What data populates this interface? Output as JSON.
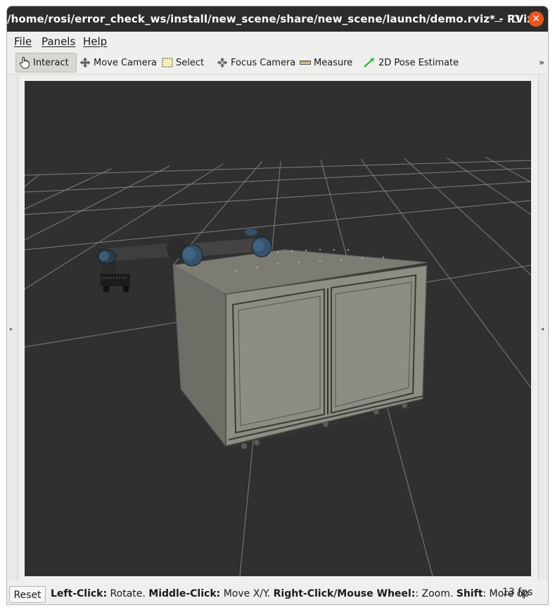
{
  "window": {
    "title": "/home/rosi/error_check_ws/install/new_scene/share/new_scene/launch/demo.rviz* - RViz",
    "close_glyph": "✕"
  },
  "menu": {
    "file": "File",
    "panels": "Panels",
    "help": "Help"
  },
  "toolbar": {
    "interact": "Interact",
    "move_camera": "Move Camera",
    "select": "Select",
    "focus_camera": "Focus Camera",
    "measure": "Measure",
    "pose_estimate": "2D Pose Estimate",
    "overflow": "»"
  },
  "side": {
    "left_arrow": "▸",
    "right_arrow": "◂"
  },
  "status": {
    "reset": "Reset",
    "left_click_key": "Left-Click:",
    "left_click_action": " Rotate. ",
    "middle_click_key": "Middle-Click:",
    "middle_click_action": " Move X/Y. ",
    "right_click_key": "Right-Click/Mouse Wheel:",
    "right_click_action": ": Zoom. ",
    "shift_key": "Shift",
    "shift_action": ": More op",
    "fps": "13 fps"
  },
  "colors": {
    "titlebar": "#2c2c2c",
    "close_button": "#e95420",
    "viewport_bg": "#303030",
    "grid_line": "#a0a0a0",
    "cabinet": "#8a8a80",
    "robot_link": "#4a4a4a",
    "robot_joint": "#2e4a60"
  }
}
